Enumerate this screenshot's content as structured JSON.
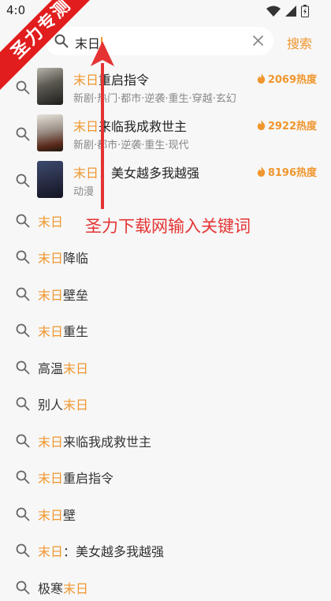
{
  "status": {
    "time": "4:0"
  },
  "ribbon": {
    "text": "圣力专测"
  },
  "search": {
    "value": "末日",
    "button_label": "搜索"
  },
  "recommendations": [
    {
      "title_hl": "末日",
      "title_rest": "重启指令",
      "tags": "新剧·热门·都市·逆袭·重生·穿越·玄幻",
      "heat": "2069热度"
    },
    {
      "title_hl": "末日",
      "title_rest": "来临我成救世主",
      "tags": "新剧·都市·逆袭·重生·现代",
      "heat": "2922热度"
    },
    {
      "title_hl": "末日",
      "title_rest": "：美女越多我越强",
      "tags": "动漫",
      "heat": "8196热度"
    }
  ],
  "suggestions": [
    {
      "before": "",
      "hl": "末日",
      "after": ""
    },
    {
      "before": "",
      "hl": "末日",
      "after": "降临"
    },
    {
      "before": "",
      "hl": "末日",
      "after": "壁垒"
    },
    {
      "before": "",
      "hl": "末日",
      "after": "重生"
    },
    {
      "before": "高温",
      "hl": "末日",
      "after": ""
    },
    {
      "before": "别人",
      "hl": "末日",
      "after": ""
    },
    {
      "before": "",
      "hl": "末日",
      "after": "来临我成救世主"
    },
    {
      "before": "",
      "hl": "末日",
      "after": "重启指令"
    },
    {
      "before": "",
      "hl": "末日",
      "after": "壁"
    },
    {
      "before": "",
      "hl": "末日",
      "after": "：美女越多我越强"
    },
    {
      "before": "极寒",
      "hl": "末日",
      "after": ""
    }
  ],
  "annotation": {
    "text": "圣力下载网输入关键词"
  },
  "colors": {
    "accent": "#f0962d",
    "annotation": "#e53333",
    "ribbon": "#e11d1d"
  },
  "icons": [
    "wifi-icon",
    "signal-icon",
    "battery-icon",
    "search-icon",
    "clear-icon",
    "fire-icon"
  ]
}
